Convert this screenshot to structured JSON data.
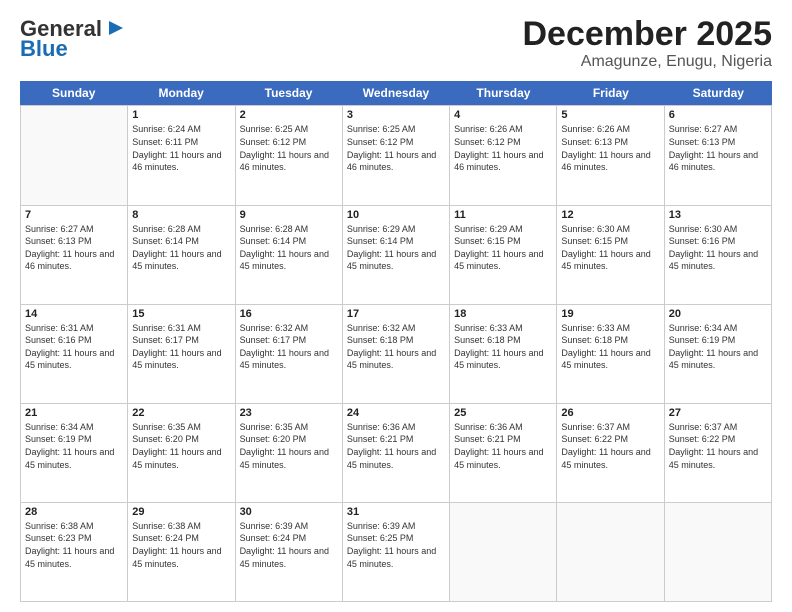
{
  "header": {
    "logo": {
      "general": "General",
      "blue": "Blue"
    },
    "month": "December 2025",
    "location": "Amagunze, Enugu, Nigeria"
  },
  "weekdays": [
    "Sunday",
    "Monday",
    "Tuesday",
    "Wednesday",
    "Thursday",
    "Friday",
    "Saturday"
  ],
  "weeks": [
    [
      {
        "day": "",
        "empty": true
      },
      {
        "day": "1",
        "sunrise": "Sunrise: 6:24 AM",
        "sunset": "Sunset: 6:11 PM",
        "daylight": "Daylight: 11 hours and 46 minutes."
      },
      {
        "day": "2",
        "sunrise": "Sunrise: 6:25 AM",
        "sunset": "Sunset: 6:12 PM",
        "daylight": "Daylight: 11 hours and 46 minutes."
      },
      {
        "day": "3",
        "sunrise": "Sunrise: 6:25 AM",
        "sunset": "Sunset: 6:12 PM",
        "daylight": "Daylight: 11 hours and 46 minutes."
      },
      {
        "day": "4",
        "sunrise": "Sunrise: 6:26 AM",
        "sunset": "Sunset: 6:12 PM",
        "daylight": "Daylight: 11 hours and 46 minutes."
      },
      {
        "day": "5",
        "sunrise": "Sunrise: 6:26 AM",
        "sunset": "Sunset: 6:13 PM",
        "daylight": "Daylight: 11 hours and 46 minutes."
      },
      {
        "day": "6",
        "sunrise": "Sunrise: 6:27 AM",
        "sunset": "Sunset: 6:13 PM",
        "daylight": "Daylight: 11 hours and 46 minutes."
      }
    ],
    [
      {
        "day": "7",
        "sunrise": "Sunrise: 6:27 AM",
        "sunset": "Sunset: 6:13 PM",
        "daylight": "Daylight: 11 hours and 46 minutes."
      },
      {
        "day": "8",
        "sunrise": "Sunrise: 6:28 AM",
        "sunset": "Sunset: 6:14 PM",
        "daylight": "Daylight: 11 hours and 45 minutes."
      },
      {
        "day": "9",
        "sunrise": "Sunrise: 6:28 AM",
        "sunset": "Sunset: 6:14 PM",
        "daylight": "Daylight: 11 hours and 45 minutes."
      },
      {
        "day": "10",
        "sunrise": "Sunrise: 6:29 AM",
        "sunset": "Sunset: 6:14 PM",
        "daylight": "Daylight: 11 hours and 45 minutes."
      },
      {
        "day": "11",
        "sunrise": "Sunrise: 6:29 AM",
        "sunset": "Sunset: 6:15 PM",
        "daylight": "Daylight: 11 hours and 45 minutes."
      },
      {
        "day": "12",
        "sunrise": "Sunrise: 6:30 AM",
        "sunset": "Sunset: 6:15 PM",
        "daylight": "Daylight: 11 hours and 45 minutes."
      },
      {
        "day": "13",
        "sunrise": "Sunrise: 6:30 AM",
        "sunset": "Sunset: 6:16 PM",
        "daylight": "Daylight: 11 hours and 45 minutes."
      }
    ],
    [
      {
        "day": "14",
        "sunrise": "Sunrise: 6:31 AM",
        "sunset": "Sunset: 6:16 PM",
        "daylight": "Daylight: 11 hours and 45 minutes."
      },
      {
        "day": "15",
        "sunrise": "Sunrise: 6:31 AM",
        "sunset": "Sunset: 6:17 PM",
        "daylight": "Daylight: 11 hours and 45 minutes."
      },
      {
        "day": "16",
        "sunrise": "Sunrise: 6:32 AM",
        "sunset": "Sunset: 6:17 PM",
        "daylight": "Daylight: 11 hours and 45 minutes."
      },
      {
        "day": "17",
        "sunrise": "Sunrise: 6:32 AM",
        "sunset": "Sunset: 6:18 PM",
        "daylight": "Daylight: 11 hours and 45 minutes."
      },
      {
        "day": "18",
        "sunrise": "Sunrise: 6:33 AM",
        "sunset": "Sunset: 6:18 PM",
        "daylight": "Daylight: 11 hours and 45 minutes."
      },
      {
        "day": "19",
        "sunrise": "Sunrise: 6:33 AM",
        "sunset": "Sunset: 6:18 PM",
        "daylight": "Daylight: 11 hours and 45 minutes."
      },
      {
        "day": "20",
        "sunrise": "Sunrise: 6:34 AM",
        "sunset": "Sunset: 6:19 PM",
        "daylight": "Daylight: 11 hours and 45 minutes."
      }
    ],
    [
      {
        "day": "21",
        "sunrise": "Sunrise: 6:34 AM",
        "sunset": "Sunset: 6:19 PM",
        "daylight": "Daylight: 11 hours and 45 minutes."
      },
      {
        "day": "22",
        "sunrise": "Sunrise: 6:35 AM",
        "sunset": "Sunset: 6:20 PM",
        "daylight": "Daylight: 11 hours and 45 minutes."
      },
      {
        "day": "23",
        "sunrise": "Sunrise: 6:35 AM",
        "sunset": "Sunset: 6:20 PM",
        "daylight": "Daylight: 11 hours and 45 minutes."
      },
      {
        "day": "24",
        "sunrise": "Sunrise: 6:36 AM",
        "sunset": "Sunset: 6:21 PM",
        "daylight": "Daylight: 11 hours and 45 minutes."
      },
      {
        "day": "25",
        "sunrise": "Sunrise: 6:36 AM",
        "sunset": "Sunset: 6:21 PM",
        "daylight": "Daylight: 11 hours and 45 minutes."
      },
      {
        "day": "26",
        "sunrise": "Sunrise: 6:37 AM",
        "sunset": "Sunset: 6:22 PM",
        "daylight": "Daylight: 11 hours and 45 minutes."
      },
      {
        "day": "27",
        "sunrise": "Sunrise: 6:37 AM",
        "sunset": "Sunset: 6:22 PM",
        "daylight": "Daylight: 11 hours and 45 minutes."
      }
    ],
    [
      {
        "day": "28",
        "sunrise": "Sunrise: 6:38 AM",
        "sunset": "Sunset: 6:23 PM",
        "daylight": "Daylight: 11 hours and 45 minutes."
      },
      {
        "day": "29",
        "sunrise": "Sunrise: 6:38 AM",
        "sunset": "Sunset: 6:24 PM",
        "daylight": "Daylight: 11 hours and 45 minutes."
      },
      {
        "day": "30",
        "sunrise": "Sunrise: 6:39 AM",
        "sunset": "Sunset: 6:24 PM",
        "daylight": "Daylight: 11 hours and 45 minutes."
      },
      {
        "day": "31",
        "sunrise": "Sunrise: 6:39 AM",
        "sunset": "Sunset: 6:25 PM",
        "daylight": "Daylight: 11 hours and 45 minutes."
      },
      {
        "day": "",
        "empty": true
      },
      {
        "day": "",
        "empty": true
      },
      {
        "day": "",
        "empty": true
      }
    ]
  ]
}
